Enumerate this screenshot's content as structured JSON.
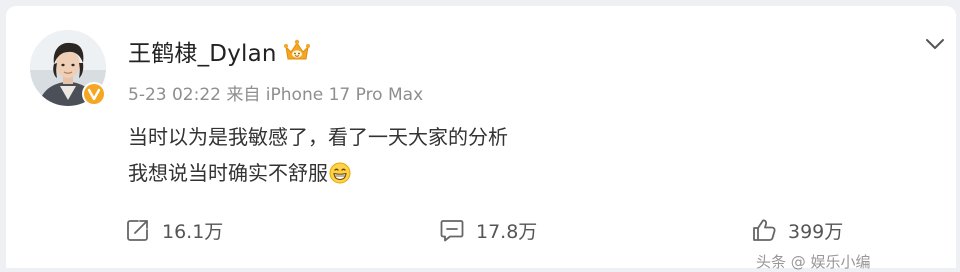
{
  "post": {
    "username": "王鹤棣_Dylan",
    "timestamp": "5-23 02:22",
    "source": "来自 iPhone 17 Pro Max",
    "text_lines": [
      "当时以为是我敏感了，看了一天大家的分析",
      "我想说当时确实不舒服"
    ],
    "emoji": "grin-emoji",
    "verified_badge": "verified-v-icon",
    "member_badge": "crown-icon",
    "accent_color": "#f5a623"
  },
  "actions": {
    "repost": {
      "icon": "repost-icon",
      "count": "16.1万"
    },
    "comment": {
      "icon": "comment-icon",
      "count": "17.8万"
    },
    "like": {
      "icon": "thumbs-up-icon",
      "count": "399万"
    }
  },
  "menu": {
    "icon": "chevron-down-icon"
  },
  "watermark": {
    "text": "头条 @ 娱乐小编"
  }
}
